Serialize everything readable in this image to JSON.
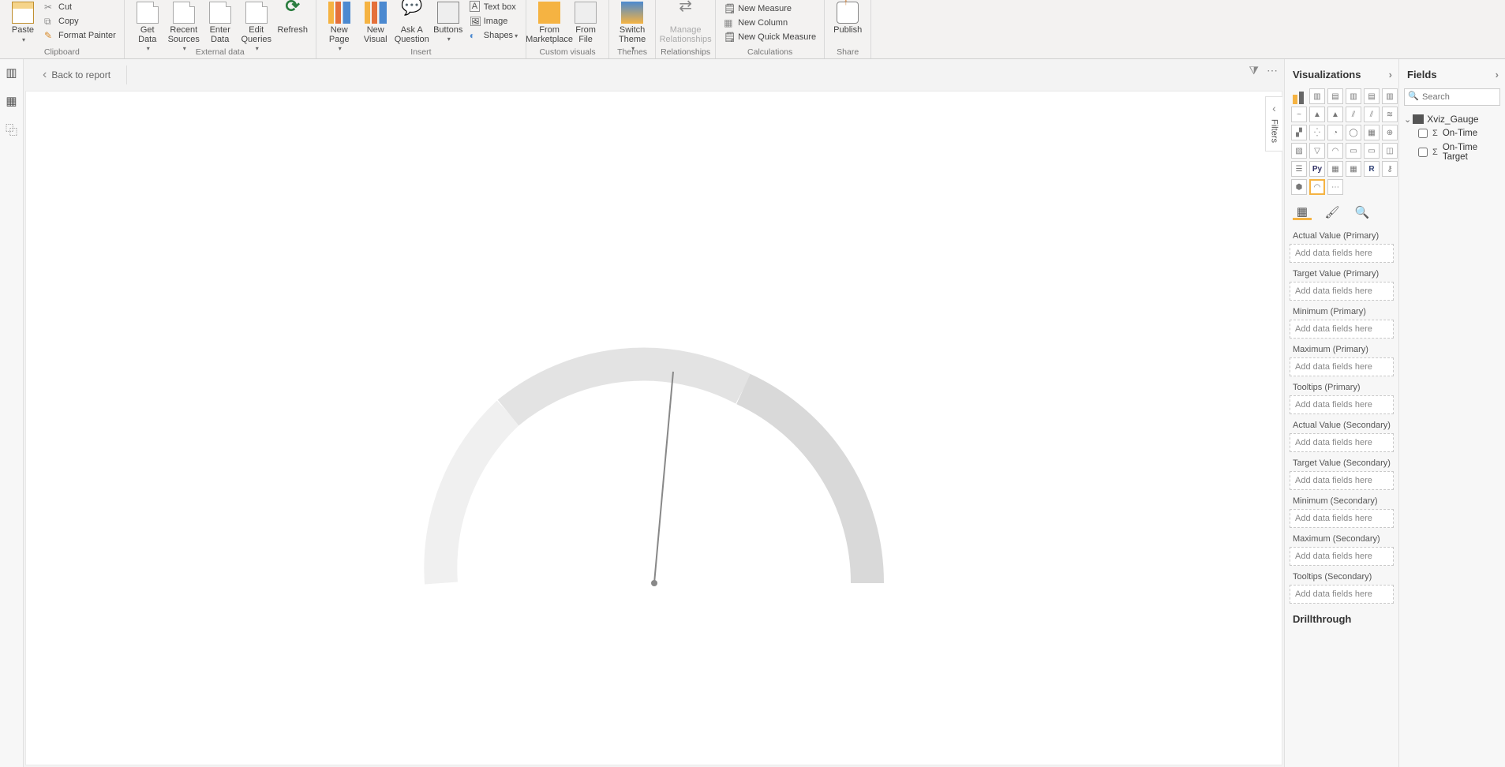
{
  "ribbon": {
    "groups": [
      {
        "label": "Clipboard",
        "paste": "Paste",
        "cut": "Cut",
        "copy": "Copy",
        "fmt": "Format Painter"
      },
      {
        "label": "External data",
        "getdata": "Get\nData",
        "recent": "Recent\nSources",
        "enter": "Enter\nData",
        "edit": "Edit\nQueries",
        "refresh": "Refresh"
      },
      {
        "label": "Insert",
        "newpage": "New\nPage",
        "newvis": "New\nVisual",
        "ask": "Ask A\nQuestion",
        "buttons": "Buttons",
        "textbox": "Text box",
        "image": "Image",
        "shapes": "Shapes"
      },
      {
        "label": "Custom visuals",
        "market": "From\nMarketplace",
        "file": "From\nFile"
      },
      {
        "label": "Themes",
        "switch": "Switch\nTheme"
      },
      {
        "label": "Relationships",
        "manage": "Manage\nRelationships"
      },
      {
        "label": "Calculations",
        "newmeas": "New Measure",
        "newcol": "New Column",
        "quick": "New Quick Measure"
      },
      {
        "label": "Share",
        "publish": "Publish"
      }
    ]
  },
  "back_to_report": "Back to report",
  "filters_tab": "Filters",
  "viz_panel": {
    "title": "Visualizations",
    "wells": [
      "Actual Value (Primary)",
      "Target Value (Primary)",
      "Minimum (Primary)",
      "Maximum (Primary)",
      "Tooltips (Primary)",
      "Actual Value (Secondary)",
      "Target Value (Secondary)",
      "Minimum (Secondary)",
      "Maximum (Secondary)",
      "Tooltips (Secondary)"
    ],
    "placeholder": "Add data fields here",
    "drill": "Drillthrough"
  },
  "fields_panel": {
    "title": "Fields",
    "search_ph": "Search",
    "table": "Xviz_Gauge",
    "cols": [
      "On-Time",
      "On-Time Target"
    ]
  },
  "chart_data": {
    "type": "gauge",
    "segments": [
      {
        "start": 0,
        "end": 50,
        "color": "#f0f0f0"
      },
      {
        "start": 50,
        "end": 120,
        "color": "#e3e3e3"
      },
      {
        "start": 120,
        "end": 180,
        "color": "#d9d9d9"
      }
    ],
    "needle_angle": 95,
    "range": [
      0,
      180
    ]
  }
}
